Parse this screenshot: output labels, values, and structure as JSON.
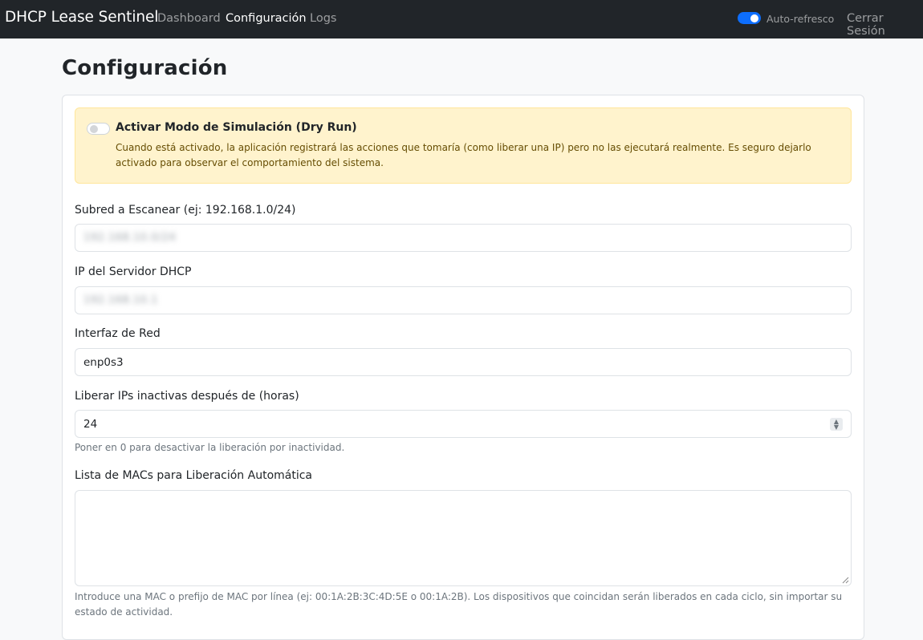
{
  "navbar": {
    "brand": "DHCP Lease Sentinel",
    "links": [
      {
        "label": "Dashboard",
        "active": false
      },
      {
        "label": "Configuración",
        "active": true
      },
      {
        "label": "Logs",
        "active": false
      }
    ],
    "auto_refresh": {
      "label": "Auto-refresco",
      "enabled": true
    },
    "logout_label": "Cerrar Sesión"
  },
  "page": {
    "title": "Configuración"
  },
  "dry_run": {
    "enabled": false,
    "title": "Activar Modo de Simulación (Dry Run)",
    "description": "Cuando está activado, la aplicación registrará las acciones que tomaría (como liberar una IP) pero no las ejecutará realmente. Es seguro dejarlo activado para observar el comportamiento del sistema."
  },
  "form": {
    "subnet": {
      "label": "Subred a Escanear (ej: 192.168.1.0/24)",
      "value": "192.168.10.0/24",
      "redacted": true
    },
    "dhcp_server": {
      "label": "IP del Servidor DHCP",
      "value": "192.168.10.1",
      "redacted": true
    },
    "interface": {
      "label": "Interfaz de Red",
      "value": "enp0s3"
    },
    "inactive_hours": {
      "label": "Liberar IPs inactivas después de (horas)",
      "value": "24",
      "help": "Poner en 0 para desactivar la liberación por inactividad."
    },
    "mac_list": {
      "label": "Lista de MACs para Liberación Automática",
      "value": "",
      "help": "Introduce una MAC o prefijo de MAC por línea (ej: 00:1A:2B:3C:4D:5E o 00:1A:2B). Los dispositivos que coincidan serán liberados en cada ciclo, sin importar su estado de actividad."
    }
  },
  "colors": {
    "navbar_bg": "#212529",
    "accent": "#0d6efd",
    "warning_bg": "#fff3cd",
    "page_bg": "#f8f9fa"
  }
}
